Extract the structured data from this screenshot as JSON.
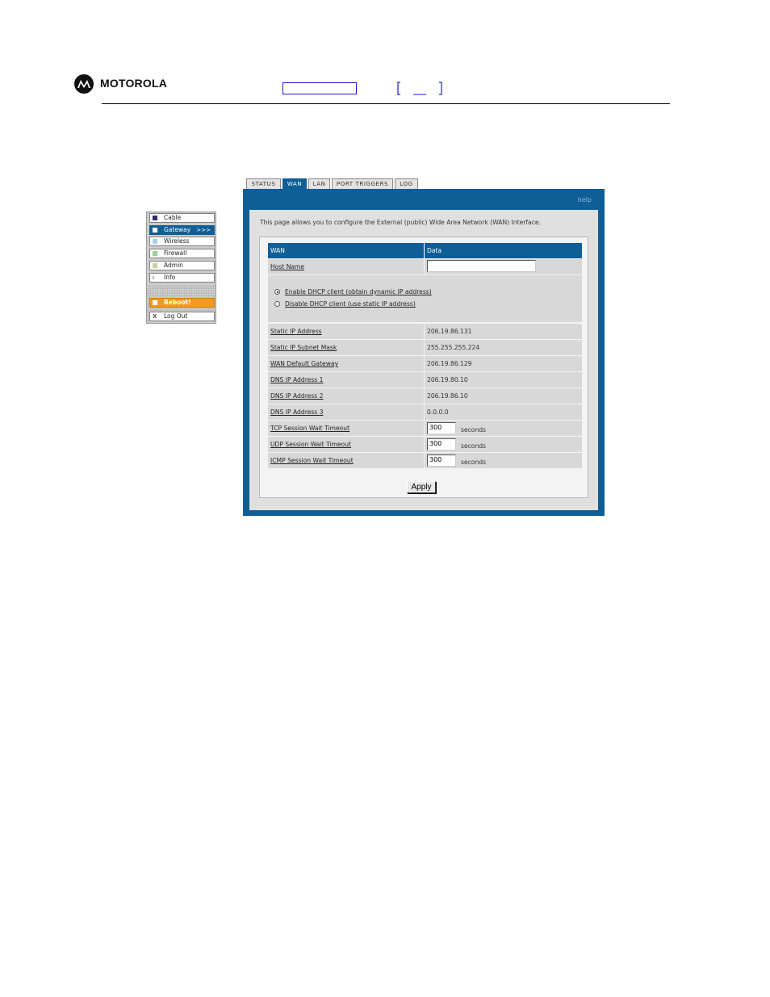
{
  "header": {
    "brand": "MOTOROLA"
  },
  "sidebar": {
    "items": [
      {
        "label": "Cable",
        "color": "#2b2e6b"
      },
      {
        "label": "Gateway",
        "color": "#ffffff",
        "suffix": ">>>"
      },
      {
        "label": "Wireless",
        "color": "#a8cfe8"
      },
      {
        "label": "Firewall",
        "color": "#9ccf9c"
      },
      {
        "label": "Admin",
        "color": "#c8d3a0"
      },
      {
        "label": "Info",
        "icon": "i"
      },
      {
        "label": "Reboot!",
        "color": "#f39a17"
      },
      {
        "label": "Log Out",
        "icon": "X"
      }
    ]
  },
  "tabs": [
    "STATUS",
    "WAN",
    "LAN",
    "PORT TRIGGERS",
    "LOG"
  ],
  "panel": {
    "help": "help",
    "intro": "This page allows you to configure the External (public) Wide Area Network (WAN) Interface."
  },
  "table": {
    "head_key": "WAN",
    "head_val": "Data",
    "host_name_label": "Host Name",
    "host_name_value": "",
    "dhcp_enable": "Enable DHCP client (obtain dynamic IP address)",
    "dhcp_disable": "Disable DHCP client (use static IP address)",
    "rows": [
      {
        "label": "Static IP Address",
        "value": "206.19.86.131"
      },
      {
        "label": "Static IP Subnet Mask",
        "value": "255.255.255.224"
      },
      {
        "label": "WAN Default Gateway",
        "value": "206.19.86.129"
      },
      {
        "label": "DNS IP Address 1",
        "value": "206.19.80.10"
      },
      {
        "label": "DNS IP Address 2",
        "value": "206.19.86.10"
      },
      {
        "label": "DNS IP Address 3",
        "value": "0.0.0.0"
      }
    ],
    "timeouts": [
      {
        "label": "TCP Session Wait Timeout",
        "value": "300",
        "unit": "seconds"
      },
      {
        "label": "UDP Session Wait Timeout",
        "value": "300",
        "unit": "seconds"
      },
      {
        "label": "ICMP Session Wait Timeout",
        "value": "300",
        "unit": "seconds"
      }
    ]
  },
  "apply_label": "Apply",
  "colors": {
    "panel_blue": "#0e5e97",
    "reboot_orange": "#f39a17"
  }
}
